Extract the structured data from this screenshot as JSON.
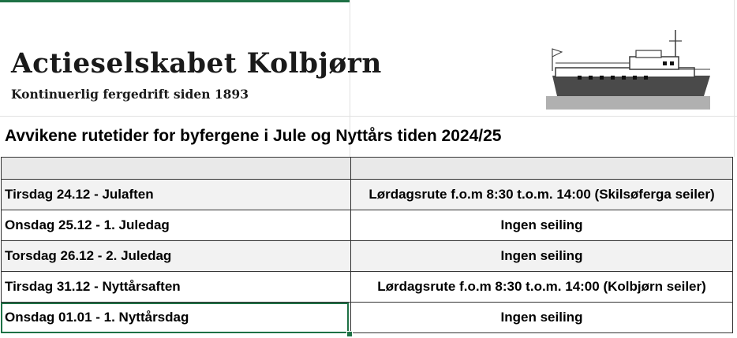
{
  "header": {
    "company_name": "Actieselskabet Kolbjørn",
    "tagline": "Kontinuerlig fergedrift siden 1893",
    "logo_icon": "ferry-icon"
  },
  "heading": "Avvikene rutetider for byfergene  i Jule og Nyttårs tiden 2024/25",
  "schedule": {
    "rows": [
      {
        "date": "Tirsdag 24.12 - Julaften",
        "info": "Lørdagsrute f.o.m 8:30  t.o.m. 14:00 (Skilsøferga seiler)"
      },
      {
        "date": "Onsdag 25.12 - 1. Juledag",
        "info": "Ingen seiling"
      },
      {
        "date": "Torsdag 26.12 - 2. Juledag",
        "info": "Ingen seiling"
      },
      {
        "date": "Tirsdag 31.12 - Nyttårsaften",
        "info": "Lørdagsrute f.o.m 8:30  t.o.m. 14:00 (Kolbjørn seiler)"
      },
      {
        "date": "Onsdag  01.01 - 1. Nyttårsdag",
        "info": "Ingen seiling"
      }
    ]
  },
  "colors": {
    "selection": "#1e7145",
    "header_row_bg": "#e9e9e9",
    "shaded_row_bg": "#f2f2f2"
  }
}
